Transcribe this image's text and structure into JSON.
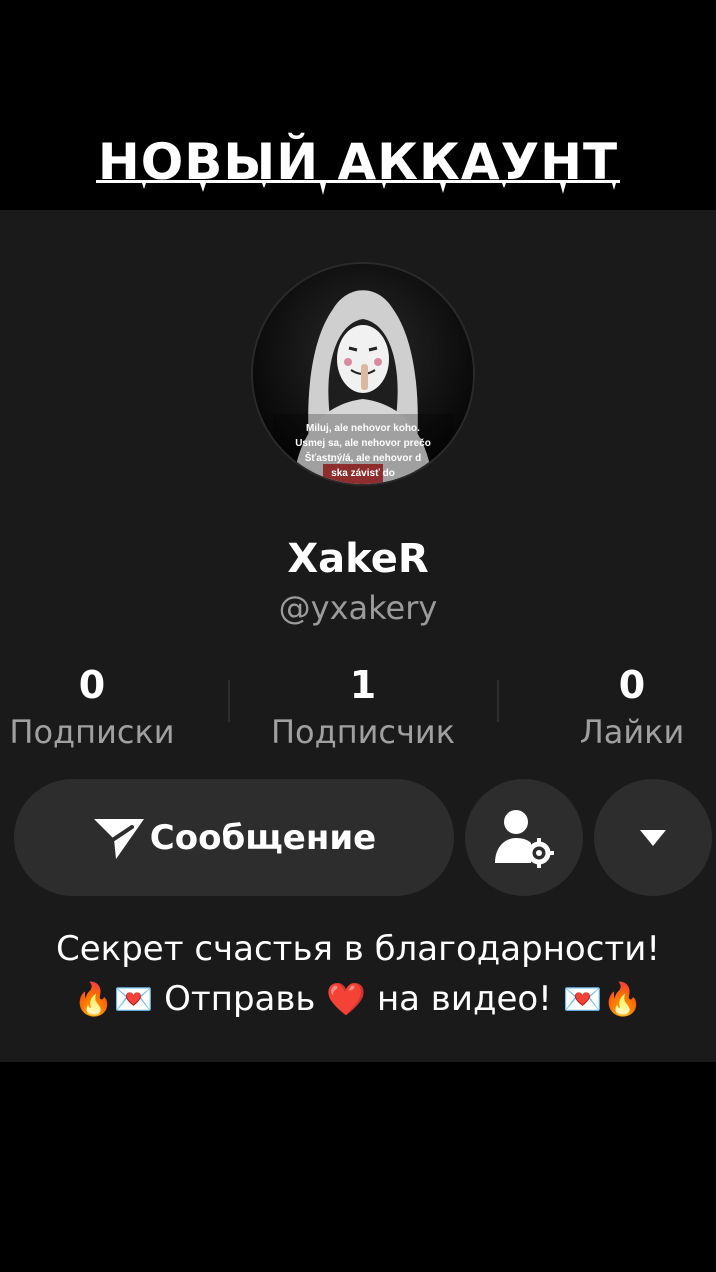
{
  "banner": {
    "title": "НОВЫЙ АККАУНТ"
  },
  "avatar": {
    "caption_lines": [
      "Miluj, ale nehovor koho.",
      "Usmej sa, ale nehovor prečo",
      "Šťastný/á, ale nehovor d",
      "ska závisť do"
    ]
  },
  "profile": {
    "display_name": "XakeR",
    "handle": "@yxakery"
  },
  "stats": [
    {
      "value": "0",
      "label": "Подписки"
    },
    {
      "value": "1",
      "label": "Подписчик"
    },
    {
      "value": "0",
      "label": "Лайки"
    }
  ],
  "actions": {
    "message_label": "Сообщение",
    "message_icon": "send-icon",
    "settings_icon": "user-settings-icon",
    "more_icon": "caret-down-icon"
  },
  "bio": {
    "line1": "Секрет счастья в благодарности!",
    "line2_part1": "Отправь",
    "line2_part2": "на видео!",
    "emoji_fire": "🔥",
    "emoji_mail": "💌",
    "emoji_heart": "❤️"
  },
  "colors": {
    "card_background": "#1a1a1a",
    "button_background": "#2d2d2d",
    "secondary_text": "#9b9b9b"
  }
}
